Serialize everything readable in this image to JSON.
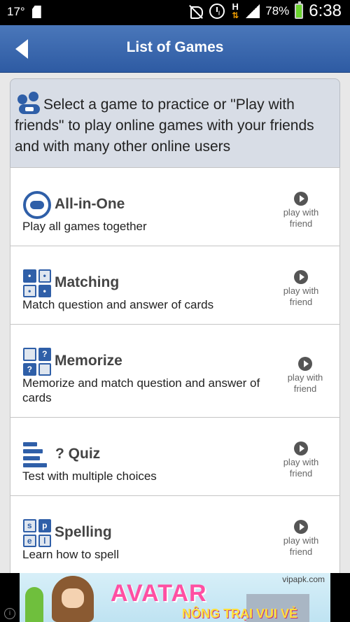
{
  "status_bar": {
    "left_text": "17°",
    "battery": "78%",
    "time": "6:38",
    "data_indicator": "H"
  },
  "header": {
    "title": "List of Games"
  },
  "intro": {
    "text": "Select a game to practice or \"Play with friends\" to play online games with your friends and with many other online users"
  },
  "play_with_friend": {
    "line1": "play with",
    "line2": "friend"
  },
  "games": [
    {
      "name": "All-in-One",
      "description": "Play all games together",
      "icon": "gamepad-icon"
    },
    {
      "name": "Matching",
      "description": "Match question and answer of cards",
      "icon": "matching-cards-icon"
    },
    {
      "name": "Memorize",
      "description": "Memorize and match question and answer of cards",
      "icon": "memorize-cards-icon"
    },
    {
      "name": "Quiz",
      "description": "Test with multiple choices",
      "icon": "quiz-icon"
    },
    {
      "name": "Spelling",
      "description": "Learn how to spell",
      "icon": "spelling-icon"
    }
  ],
  "icon_glyphs": {
    "quiz_mark": "?",
    "memorize_q": "?",
    "spelling": [
      "s",
      "p",
      "e",
      "l"
    ]
  },
  "ad": {
    "title": "AVATAR",
    "subtitle": "NÔNG TRẠI VUI VẺ",
    "site": "vipapk.com",
    "info": "i"
  },
  "colors": {
    "header": "#3b68b0",
    "accent": "#2f5fa8",
    "battery": "#6bd42e"
  }
}
